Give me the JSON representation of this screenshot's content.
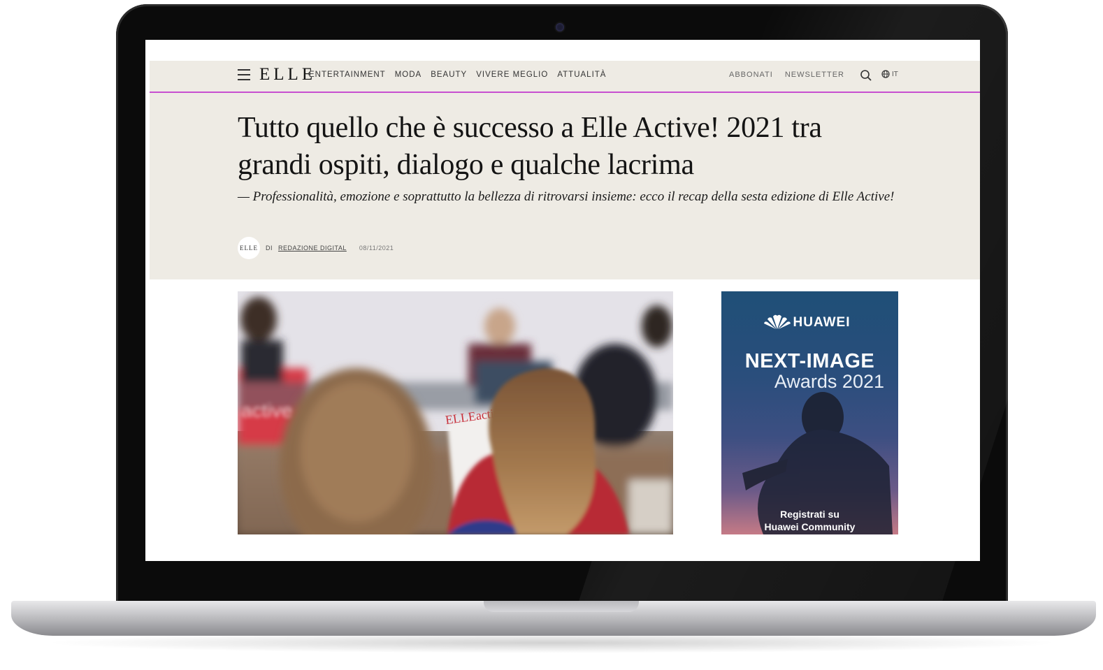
{
  "nav": {
    "logo": "ELLE",
    "items": [
      "ENTERTAINMENT",
      "MODA",
      "BEAUTY",
      "VIVERE MEGLIO",
      "ATTUALITÀ"
    ],
    "right_items": [
      "ABBONATI",
      "NEWSLETTER"
    ],
    "language": "IT",
    "underline_color": "#c74fd0"
  },
  "article": {
    "headline": "Tutto quello che è successo a Elle Active! 2021 tra grandi ospiti, dialogo e qualche lacrima",
    "standfirst": "— Professionalità, emozione e soprattutto la bellezza di ritrovarsi insieme: ecco il recap della sesta edizione di Elle Active!",
    "byline_prefix": "DI",
    "author": "REDAZIONE DIGITAL",
    "date": "08/11/2021",
    "avatar_label": "ELLE"
  },
  "photo": {
    "brochure_text": "ELLEactive",
    "banner_text": "active"
  },
  "ad": {
    "brand": "HUAWEI",
    "title": "NEXT-IMAGE",
    "subtitle": "Awards 2021",
    "cta": "Registrati su",
    "cta_line2": "Huawei Community"
  },
  "colors": {
    "hero_bg": "#eeebe4",
    "accent": "#c74fd0"
  }
}
